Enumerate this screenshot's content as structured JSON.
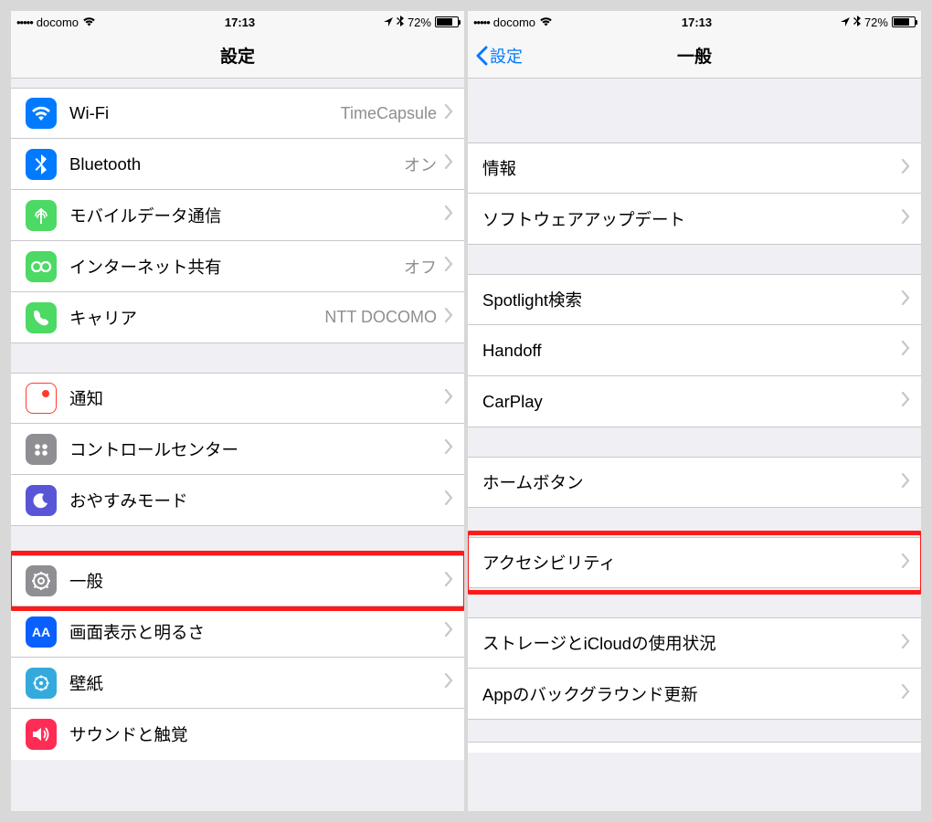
{
  "status": {
    "carrier": "docomo",
    "time": "17:13",
    "battery_pct": "72%",
    "signal_dots": "•••••"
  },
  "left": {
    "title": "設定",
    "groups": [
      {
        "rows": [
          {
            "icon": "wifi-icon",
            "label": "Wi-Fi",
            "value": "TimeCapsule"
          },
          {
            "icon": "bluetooth-icon",
            "label": "Bluetooth",
            "value": "オン"
          },
          {
            "icon": "cellular-icon",
            "label": "モバイルデータ通信",
            "value": ""
          },
          {
            "icon": "hotspot-icon",
            "label": "インターネット共有",
            "value": "オフ"
          },
          {
            "icon": "carrier-icon",
            "label": "キャリア",
            "value": "NTT DOCOMO"
          }
        ]
      },
      {
        "rows": [
          {
            "icon": "notifications-icon",
            "label": "通知",
            "value": ""
          },
          {
            "icon": "control-center-icon",
            "label": "コントロールセンター",
            "value": ""
          },
          {
            "icon": "do-not-disturb-icon",
            "label": "おやすみモード",
            "value": ""
          }
        ]
      },
      {
        "rows": [
          {
            "icon": "general-icon",
            "label": "一般",
            "value": "",
            "highlight": true
          },
          {
            "icon": "display-icon",
            "label": "画面表示と明るさ",
            "value": ""
          },
          {
            "icon": "wallpaper-icon",
            "label": "壁紙",
            "value": ""
          },
          {
            "icon": "sounds-icon",
            "label": "サウンドと触覚",
            "value": ""
          }
        ]
      }
    ]
  },
  "right": {
    "back": "設定",
    "title": "一般",
    "groups": [
      {
        "rows": [
          {
            "label": "情報"
          },
          {
            "label": "ソフトウェアアップデート"
          }
        ]
      },
      {
        "rows": [
          {
            "label": "Spotlight検索"
          },
          {
            "label": "Handoff"
          },
          {
            "label": "CarPlay"
          }
        ]
      },
      {
        "rows": [
          {
            "label": "ホームボタン"
          }
        ]
      },
      {
        "rows": [
          {
            "label": "アクセシビリティ",
            "highlight": true
          }
        ]
      },
      {
        "rows": [
          {
            "label": "ストレージとiCloudの使用状況"
          },
          {
            "label": "Appのバックグラウンド更新"
          }
        ]
      }
    ]
  }
}
